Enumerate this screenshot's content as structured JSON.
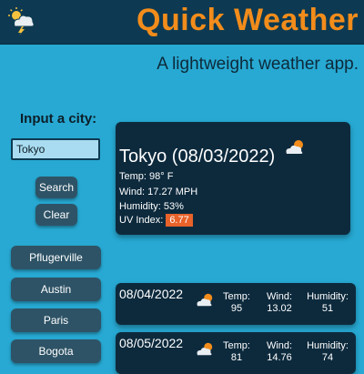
{
  "app": {
    "title": "Quick Weather",
    "tagline": "A lightweight weather app.",
    "colors": {
      "header_bg": "#0d3a52",
      "title": "#f28c1b",
      "page_bg": "#27a9d3",
      "card_bg": "#0d2a3d",
      "uv_badge": "#e8622a"
    },
    "logo_icon": "storm-cloud-icon"
  },
  "search": {
    "label": "Input a city:",
    "input_value": "Tokyo",
    "search_label": "Search",
    "clear_label": "Clear"
  },
  "history": [
    "Pflugerville",
    "Austin",
    "Paris",
    "Bogota"
  ],
  "current": {
    "title": "Tokyo (08/03/2022)",
    "icon": "sun-behind-cloud-icon",
    "temp": "Temp: 98° F",
    "wind": "Wind: 17.27 MPH",
    "humidity": "Humidity: 53%",
    "uv_label": "UV Index:",
    "uv_value": "6.77"
  },
  "forecast_labels": {
    "temp": "Temp:",
    "wind": "Wind:",
    "humidity": "Humidity:"
  },
  "forecast": [
    {
      "date": "08/04/2022",
      "icon": "sun-behind-cloud-icon",
      "temp": "95",
      "wind": "13.02",
      "humidity": "51"
    },
    {
      "date": "08/05/2022",
      "icon": "sun-behind-cloud-icon",
      "temp": "81",
      "wind": "14.76",
      "humidity": "74"
    }
  ]
}
